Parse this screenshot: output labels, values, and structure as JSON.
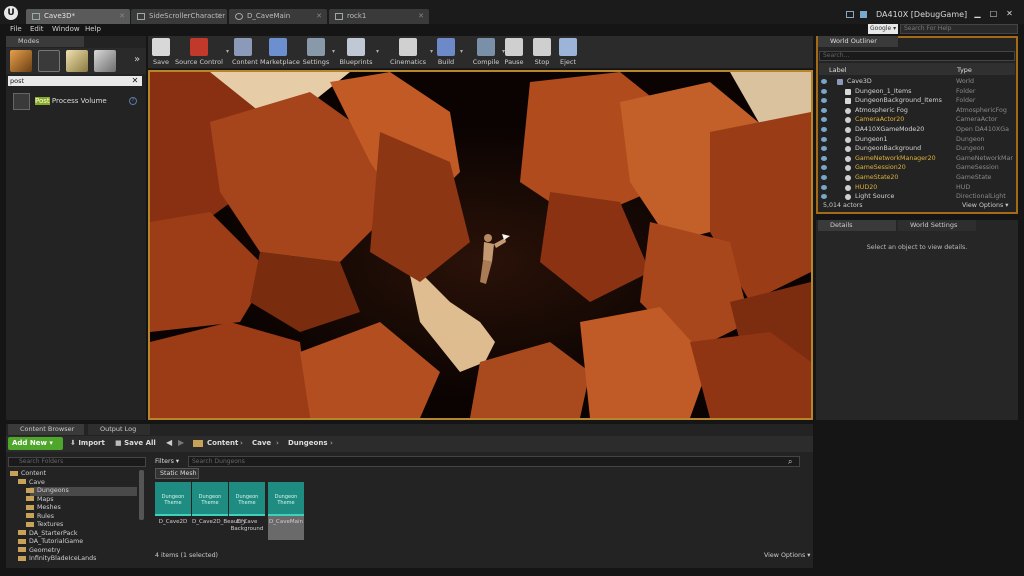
{
  "window": {
    "logo": "U",
    "tabs": [
      "Cave3D*",
      "SideScrollerCharacter",
      "D_CaveMain",
      "rock1"
    ],
    "project": "DA410X [DebugGame]",
    "google_label": "Google ▾",
    "search_help_placeholder": "Search For Help"
  },
  "menu": [
    "File",
    "Edit",
    "Window",
    "Help"
  ],
  "modes": {
    "tab": "Modes",
    "search_value": "post",
    "result_highlight": "Post",
    "result_rest": " Process Volume",
    "help_glyph": "?"
  },
  "toolbar": {
    "buttons": [
      {
        "label": "Save",
        "icon": "save-icon",
        "color": "#d8d8d8"
      },
      {
        "label": "Source Control",
        "icon": "source-control-icon",
        "color": "#c0392b"
      },
      {
        "label": "Content",
        "icon": "content-icon",
        "color": "#8a9ab8"
      },
      {
        "label": "Marketplace",
        "icon": "marketplace-icon",
        "color": "#6c8fd0"
      },
      {
        "label": "Settings",
        "icon": "settings-icon",
        "color": "#8899aa"
      },
      {
        "label": "Blueprints",
        "icon": "blueprints-icon",
        "color": "#bfc8d4"
      },
      {
        "label": "Cinematics",
        "icon": "cinematics-icon",
        "color": "#d0d0d0"
      },
      {
        "label": "Build",
        "icon": "build-icon",
        "color": "#6d89c8"
      },
      {
        "label": "Compile",
        "icon": "compile-icon",
        "color": "#7a8fa8"
      },
      {
        "label": "Pause",
        "icon": "pause-icon",
        "color": "#cfcfcf"
      },
      {
        "label": "Stop",
        "icon": "stop-icon",
        "color": "#cfcfcf"
      },
      {
        "label": "Eject",
        "icon": "eject-icon",
        "color": "#9bb4d8"
      }
    ]
  },
  "outliner": {
    "tab": "World Outliner",
    "search_placeholder": "Search...",
    "col_label": "Label",
    "col_type": "Type",
    "rows": [
      {
        "label": "Cave3D",
        "type": "World",
        "indent": 0,
        "kind": "world",
        "gold": false
      },
      {
        "label": "Dungeon_1_Items",
        "type": "Folder",
        "indent": 1,
        "kind": "folder",
        "gold": false
      },
      {
        "label": "DungeonBackground_Items",
        "type": "Folder",
        "indent": 1,
        "kind": "folder",
        "gold": false
      },
      {
        "label": "Atmospheric Fog",
        "type": "AtmosphericFog",
        "indent": 1,
        "kind": "actor",
        "gold": false
      },
      {
        "label": "CameraActor20",
        "type": "CameraActor",
        "indent": 1,
        "kind": "actor",
        "gold": true
      },
      {
        "label": "DA410XGameMode20",
        "type": "Open DA410XGa",
        "indent": 1,
        "kind": "actor",
        "gold": false
      },
      {
        "label": "Dungeon1",
        "type": "Dungeon",
        "indent": 1,
        "kind": "actor",
        "gold": false
      },
      {
        "label": "DungeonBackground",
        "type": "Dungeon",
        "indent": 1,
        "kind": "actor",
        "gold": false
      },
      {
        "label": "GameNetworkManager20",
        "type": "GameNetworkMar",
        "indent": 1,
        "kind": "actor",
        "gold": true
      },
      {
        "label": "GameSession20",
        "type": "GameSession",
        "indent": 1,
        "kind": "actor",
        "gold": true
      },
      {
        "label": "GameState20",
        "type": "GameState",
        "indent": 1,
        "kind": "actor",
        "gold": true
      },
      {
        "label": "HUD20",
        "type": "HUD",
        "indent": 1,
        "kind": "actor",
        "gold": true
      },
      {
        "label": "Light Source",
        "type": "DirectionalLight",
        "indent": 1,
        "kind": "actor",
        "gold": false
      }
    ],
    "actors": "5,014 actors",
    "view_options": "View Options ▾"
  },
  "details": {
    "tab": "Details",
    "tab2": "World Settings",
    "empty_message": "Select an object to view details."
  },
  "content_browser": {
    "tab": "Content Browser",
    "tab2": "Output Log",
    "add_new": "Add New ▾",
    "import": "Import",
    "save_all": "Save All",
    "breadcrumb": [
      "Content",
      "Cave",
      "Dungeons"
    ],
    "folders_search_placeholder": "Search Folders",
    "tree": [
      {
        "label": "Content",
        "indent": 0
      },
      {
        "label": "Cave",
        "indent": 1
      },
      {
        "label": "Dungeons",
        "indent": 2
      },
      {
        "label": "Maps",
        "indent": 2
      },
      {
        "label": "Meshes",
        "indent": 2
      },
      {
        "label": "Rules",
        "indent": 2
      },
      {
        "label": "Textures",
        "indent": 2
      },
      {
        "label": "DA_StarterPack",
        "indent": 1
      },
      {
        "label": "DA_TutorialGame",
        "indent": 1
      },
      {
        "label": "Geometry",
        "indent": 1
      },
      {
        "label": "InfinityBladeIceLands",
        "indent": 1
      }
    ],
    "filters": "Filters ▾",
    "asset_search_placeholder": "Search Dungeons",
    "filter_chip": "Static Mesh",
    "assets": [
      {
        "thumb": "Dungeon Theme",
        "name": "D_Cave2D"
      },
      {
        "thumb": "Dungeon Theme",
        "name": "D_Cave2D_Beautify"
      },
      {
        "thumb": "Dungeon Theme",
        "name": "D_Cave Background"
      },
      {
        "thumb": "Dungeon Theme",
        "name": "D_CaveMain"
      }
    ],
    "items_count": "4 items (1 selected)",
    "view_options": "View Options ▾"
  }
}
